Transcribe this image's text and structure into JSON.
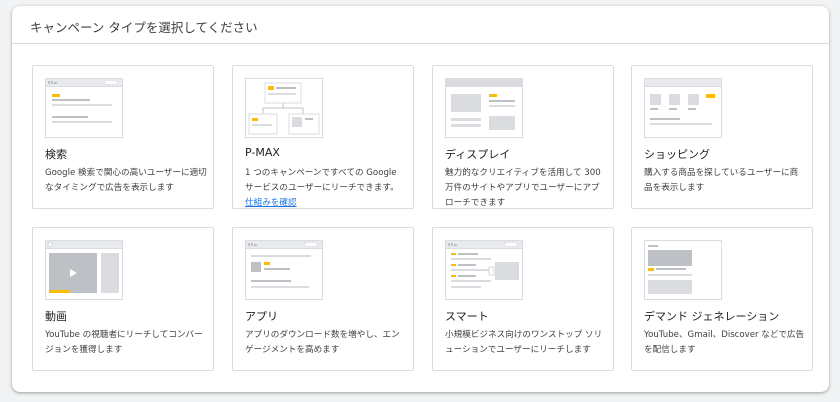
{
  "header": {
    "title": "キャンペーン タイプを選択してください"
  },
  "cards": [
    {
      "title": "検索",
      "desc": "Google 検索で関心の高いユーザーに適切なタイミングで広告を表示します",
      "illustration": "search-illustration"
    },
    {
      "title": "P-MAX",
      "desc": "1 つのキャンペーンですべての Google サービスのユーザーにリーチできます。",
      "link": "仕組みを確認",
      "illustration": "pmax-illustration"
    },
    {
      "title": "ディスプレイ",
      "desc": "魅力的なクリエイティブを活用して 300 万件のサイトやアプリでユーザーにアプローチできます",
      "illustration": "display-illustration"
    },
    {
      "title": "ショッピング",
      "desc": "購入する商品を探しているユーザーに商品を表示します",
      "illustration": "shopping-illustration"
    },
    {
      "title": "動画",
      "desc": "YouTube の視聴者にリーチしてコンバージョンを獲得します",
      "illustration": "video-illustration"
    },
    {
      "title": "アプリ",
      "desc": "アプリのダウンロード数を増やし、エンゲージメントを高めます",
      "illustration": "app-illustration"
    },
    {
      "title": "スマート",
      "desc": "小規模ビジネス向けのワンストップ ソリューションでユーザーにリーチします",
      "illustration": "smart-illustration"
    },
    {
      "title": "デマンド ジェネレーション",
      "desc": "YouTube、Gmail、Discover などで広告を配信します",
      "illustration": "demand-gen-illustration"
    }
  ],
  "colors": {
    "accent": "#fbbc04",
    "illus_bg": "#dadce0",
    "illus_line": "#bdc1c6",
    "link": "#1a73e8"
  }
}
